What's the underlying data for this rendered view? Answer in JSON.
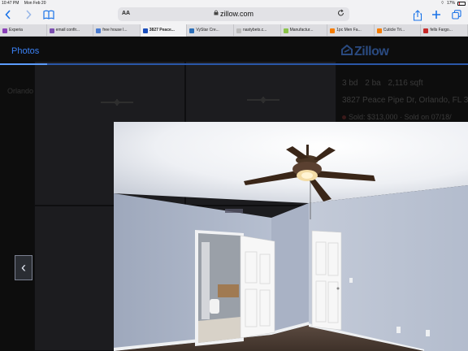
{
  "status_bar": {
    "time": "10:47 PM",
    "date": "Mon Feb 20",
    "battery": "17%"
  },
  "toolbar": {
    "text_size_label": "AA",
    "url": "zillow.com",
    "icons": {
      "back": "chevron-left-icon",
      "forward": "chevron-right-icon",
      "bookmarks": "book-icon",
      "lock": "lock-icon",
      "reload": "reload-icon",
      "share": "share-icon",
      "new_tab": "plus-icon",
      "tab_overview": "tabs-icon"
    },
    "accent": "#1a73e8"
  },
  "tabs": [
    {
      "label": "Experia",
      "fav_color": "#8a3fb8"
    },
    {
      "label": "email confir...",
      "fav_color": "#7b4fb0"
    },
    {
      "label": "free house l...",
      "fav_color": "#4a7bd0"
    },
    {
      "label": "3827 Peace...",
      "fav_color": "#1a4dbb",
      "active": true
    },
    {
      "label": "VyStar Cre...",
      "fav_color": "#2c6fb8"
    },
    {
      "label": "nastybets.c...",
      "fav_color": "#bbbbbb"
    },
    {
      "label": "Manufactur...",
      "fav_color": "#8bc34a"
    },
    {
      "label": "1pc Men Fa...",
      "fav_color": "#f57c00"
    },
    {
      "label": "Cuticle Tri...",
      "fav_color": "#f57c00"
    },
    {
      "label": "fells Fargo...",
      "fav_color": "#c62828"
    }
  ],
  "page": {
    "photos_tab": "Photos",
    "logo": "Zillow",
    "side_label": "Orlando",
    "facts": [
      "3 bd",
      "2 ba",
      "2,116 sqft"
    ],
    "address": "3827 Peace Pipe Dr, Orlando, FL 3",
    "sold": "Sold: $313,000 · Sold on 07/18/"
  },
  "viewer": {
    "prev_button_glyph": "‹",
    "prev_icon": "chevron-left-icon"
  }
}
